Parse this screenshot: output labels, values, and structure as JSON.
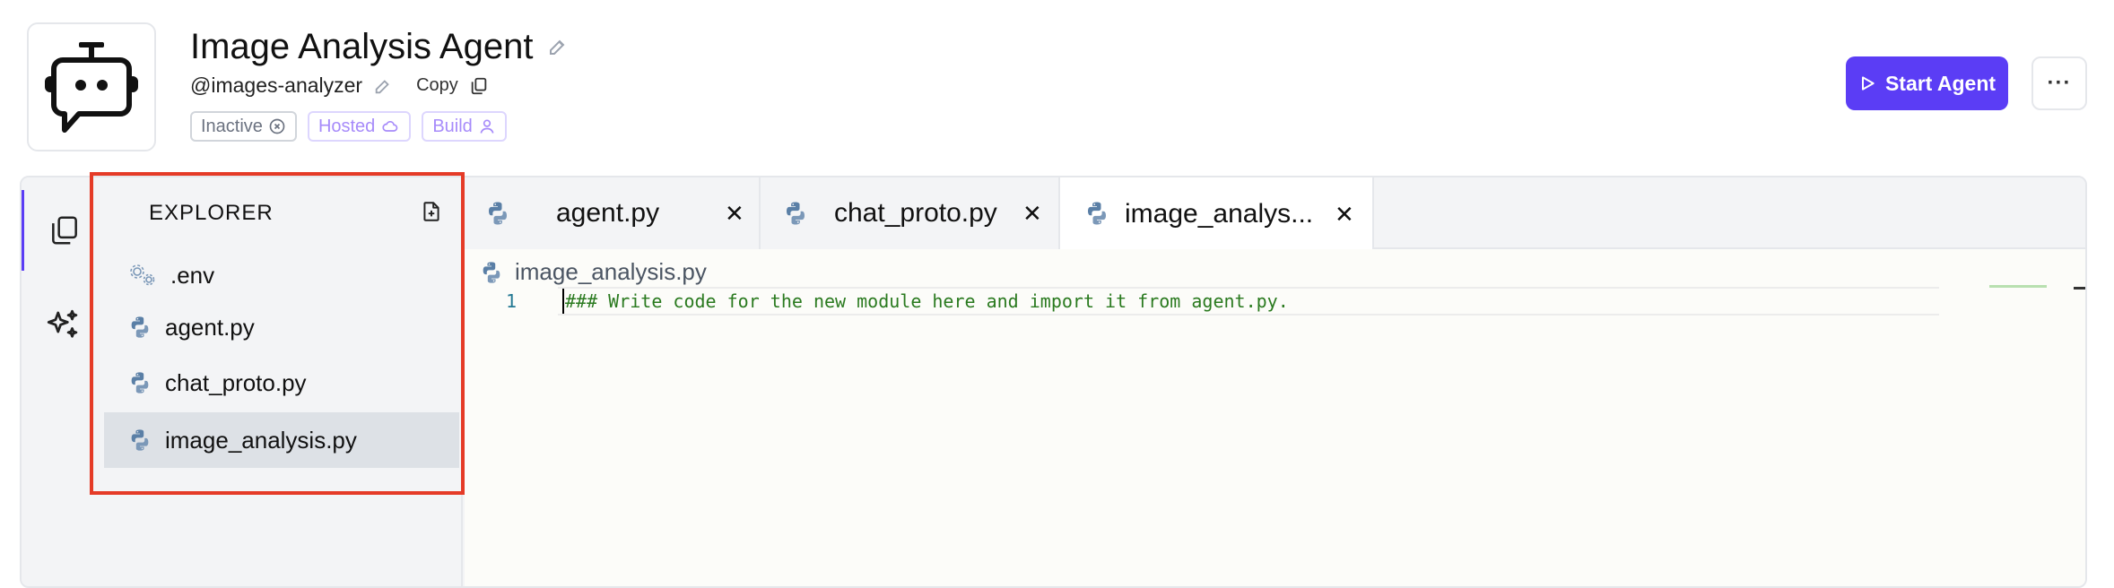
{
  "header": {
    "title": "Image Analysis Agent",
    "handle": "@images-analyzer",
    "copy_label": "Copy",
    "badges": [
      {
        "label": "Inactive",
        "icon": "circle-x-icon"
      },
      {
        "label": "Hosted",
        "icon": "cloud-icon"
      },
      {
        "label": "Build",
        "icon": "user-icon"
      }
    ],
    "start_button": "Start Agent",
    "more_button": "···"
  },
  "explorer": {
    "title": "EXPLORER",
    "files": [
      {
        "name": ".env",
        "icon": "gears-icon",
        "selected": false
      },
      {
        "name": "agent.py",
        "icon": "python-icon",
        "selected": false
      },
      {
        "name": "chat_proto.py",
        "icon": "python-icon",
        "selected": false
      },
      {
        "name": "image_analysis.py",
        "icon": "python-icon",
        "selected": true
      }
    ]
  },
  "tabs": [
    {
      "label": "agent.py",
      "active": false
    },
    {
      "label": "chat_proto.py",
      "active": false
    },
    {
      "label": "image_analys...",
      "active": true
    }
  ],
  "editor": {
    "breadcrumb": "image_analysis.py",
    "lines": [
      {
        "number": "1",
        "text": "### Write code for the new module here and import it from agent.py."
      }
    ]
  },
  "colors": {
    "accent": "#5b3df5",
    "highlight_border": "#e53b27",
    "comment": "#2a7a1f",
    "python_icon": "#5a7fa6"
  }
}
